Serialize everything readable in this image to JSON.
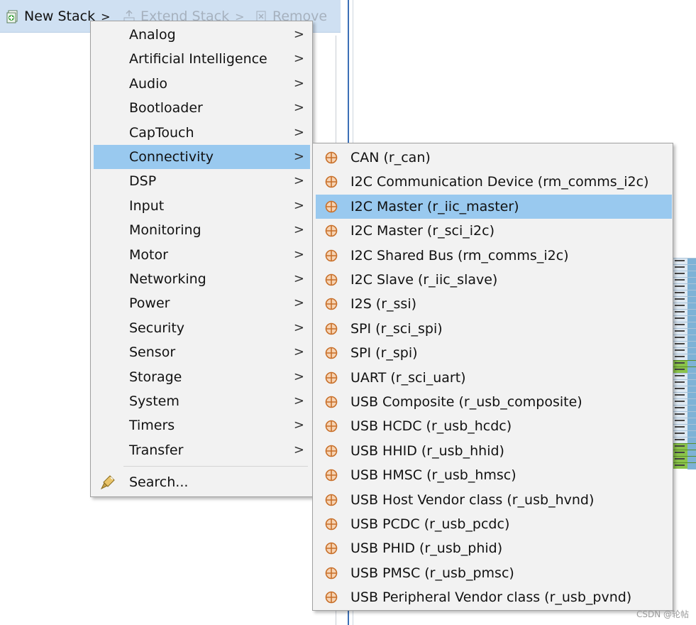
{
  "toolbar": {
    "new_stack": "New Stack",
    "extend_stack": "Extend Stack",
    "remove": "Remove"
  },
  "main_menu": {
    "items": [
      {
        "label": "Analog"
      },
      {
        "label": "Artificial Intelligence"
      },
      {
        "label": "Audio"
      },
      {
        "label": "Bootloader"
      },
      {
        "label": "CapTouch"
      },
      {
        "label": "Connectivity",
        "selected": true
      },
      {
        "label": "DSP"
      },
      {
        "label": "Input"
      },
      {
        "label": "Monitoring"
      },
      {
        "label": "Motor"
      },
      {
        "label": "Networking"
      },
      {
        "label": "Power"
      },
      {
        "label": "Security"
      },
      {
        "label": "Sensor"
      },
      {
        "label": "Storage"
      },
      {
        "label": "System"
      },
      {
        "label": "Timers"
      },
      {
        "label": "Transfer"
      }
    ],
    "search": "Search...",
    "arrow": ">"
  },
  "sub_menu": {
    "items": [
      {
        "label": "CAN (r_can)"
      },
      {
        "label": "I2C Communication Device (rm_comms_i2c)"
      },
      {
        "label": "I2C Master (r_iic_master)",
        "selected": true
      },
      {
        "label": "I2C Master (r_sci_i2c)"
      },
      {
        "label": "I2C Shared Bus (rm_comms_i2c)"
      },
      {
        "label": "I2C Slave (r_iic_slave)"
      },
      {
        "label": "I2S (r_ssi)"
      },
      {
        "label": "SPI (r_sci_spi)"
      },
      {
        "label": "SPI (r_spi)"
      },
      {
        "label": "UART (r_sci_uart)"
      },
      {
        "label": "USB Composite (r_usb_composite)"
      },
      {
        "label": "USB HCDC (r_usb_hcdc)"
      },
      {
        "label": "USB HHID (r_usb_hhid)"
      },
      {
        "label": "USB HMSC (r_usb_hmsc)"
      },
      {
        "label": "USB Host Vendor class (r_usb_hvnd)"
      },
      {
        "label": "USB PCDC (r_usb_pcdc)"
      },
      {
        "label": "USB PHID (r_usb_phid)"
      },
      {
        "label": "USB PMSC (r_usb_pmsc)"
      },
      {
        "label": "USB Peripheral Vendor class (r_usb_pvnd)"
      }
    ],
    "icon": "module-crosshair-icon"
  },
  "colors": {
    "selection": "#99c9ef",
    "toolbar": "#cfe0f2",
    "menu_bg": "#f2f2f2",
    "icon_orange": "#c8702a"
  },
  "watermark": "CSDN @轮帖"
}
